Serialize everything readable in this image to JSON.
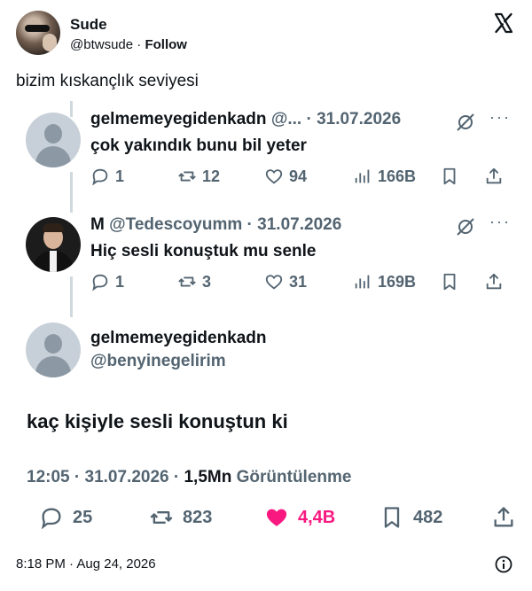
{
  "author": {
    "name": "Sude",
    "handle": "@btwsude",
    "separator": " · ",
    "follow_label": "Follow"
  },
  "post_text": "bizim kıskançlık seviyesi",
  "thread": {
    "reply1": {
      "name": "gelmemeyegidenkadn",
      "handle_truncated": "@...",
      "date": "31.07.2026",
      "text": "çok yakındık bunu bil yeter",
      "replies": "1",
      "reposts": "12",
      "likes": "94",
      "views": "166B"
    },
    "reply2": {
      "name": "M",
      "handle": "@Tedescoyumm",
      "date": "31.07.2026",
      "text": "Hiç sesli konuştuk mu senle",
      "replies": "1",
      "reposts": "3",
      "likes": "31",
      "views": "169B"
    },
    "main": {
      "name": "gelmemeyegidenkadn",
      "handle": "@benyinegelirim",
      "text": "kaç kişiyle sesli konuştun ki",
      "time": "12:05",
      "date": "31.07.2026",
      "views": "1,5Mn",
      "views_label": "Görüntülenme",
      "replies": "25",
      "reposts": "823",
      "likes": "4,4B",
      "bookmarks": "482"
    }
  },
  "footer": {
    "timestamp": "8:18 PM · Aug 24, 2026"
  },
  "colors": {
    "text": "#0f1419",
    "muted": "#536471",
    "like": "#f91880",
    "thread_line": "#cfd9de"
  },
  "icons": [
    "x-logo-icon",
    "grok-icon",
    "more-icon",
    "reply-icon",
    "repost-icon",
    "like-icon",
    "views-icon",
    "bookmark-icon",
    "share-icon",
    "info-icon"
  ]
}
